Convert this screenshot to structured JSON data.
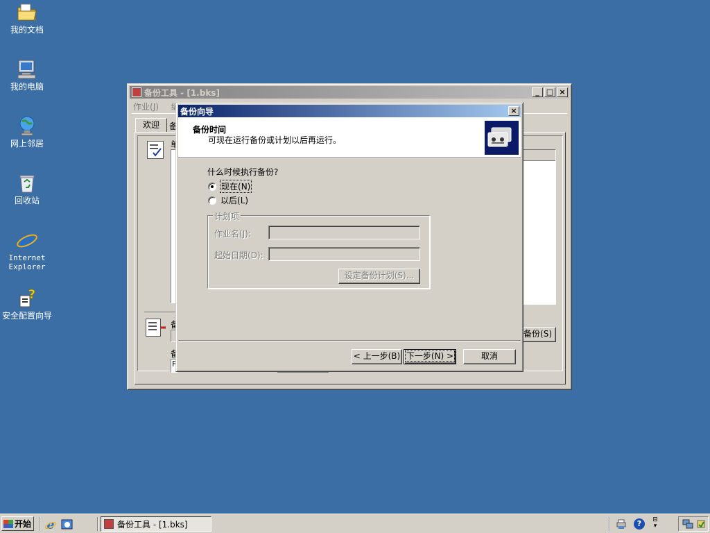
{
  "desktop": {
    "icons": [
      {
        "label": "我的文档",
        "icon": "my-documents-icon"
      },
      {
        "label": "我的电脑",
        "icon": "my-computer-icon"
      },
      {
        "label": "网上邻居",
        "icon": "network-places-icon"
      },
      {
        "label": "回收站",
        "icon": "recycle-bin-icon"
      },
      {
        "label": "Internet Explorer",
        "icon": "internet-explorer-icon"
      },
      {
        "label": "安全配置向导",
        "icon": "security-wizard-icon"
      }
    ],
    "background_color": "#3a6ea5"
  },
  "backup_window": {
    "title": "备份工具 - [1.bks]",
    "menu": {
      "job": "作业",
      "job_key": "(J)",
      "edit_fragment": "编"
    },
    "tabs": {
      "welcome": "欢迎"
    },
    "partial_labels": {
      "single": "单",
      "backup_a": "备",
      "backup_b": "备",
      "backup_button": "备份",
      "backup_key": "(S)",
      "field_fragment": "F"
    }
  },
  "wizard": {
    "title": "备份向导",
    "header_title": "备份时间",
    "header_subtitle": "可现在运行备份或计划以后再运行。",
    "question": "什么时候执行备份?",
    "options": [
      {
        "label": "现在",
        "key": "(N)",
        "selected": true
      },
      {
        "label": "以后",
        "key": "(L)",
        "selected": false
      }
    ],
    "schedule_group": {
      "label": "计划项",
      "job_name_label": "作业名",
      "job_name_key": "(J)",
      "job_name_value": "",
      "start_date_label": "起始日期",
      "start_date_key": "(D)",
      "start_date_value": "",
      "set_schedule_label": "设定备份计划",
      "set_schedule_key": "(S)..."
    },
    "buttons": {
      "back": "< 上一步",
      "back_key": "(B)",
      "next": "下一步",
      "next_key": "(N)",
      "next_suffix": " >",
      "cancel": "取消"
    }
  },
  "taskbar": {
    "start_label": "开始",
    "task_label": "备份工具 - [1.bks]",
    "colors": {
      "accent": "#0a246a"
    }
  }
}
